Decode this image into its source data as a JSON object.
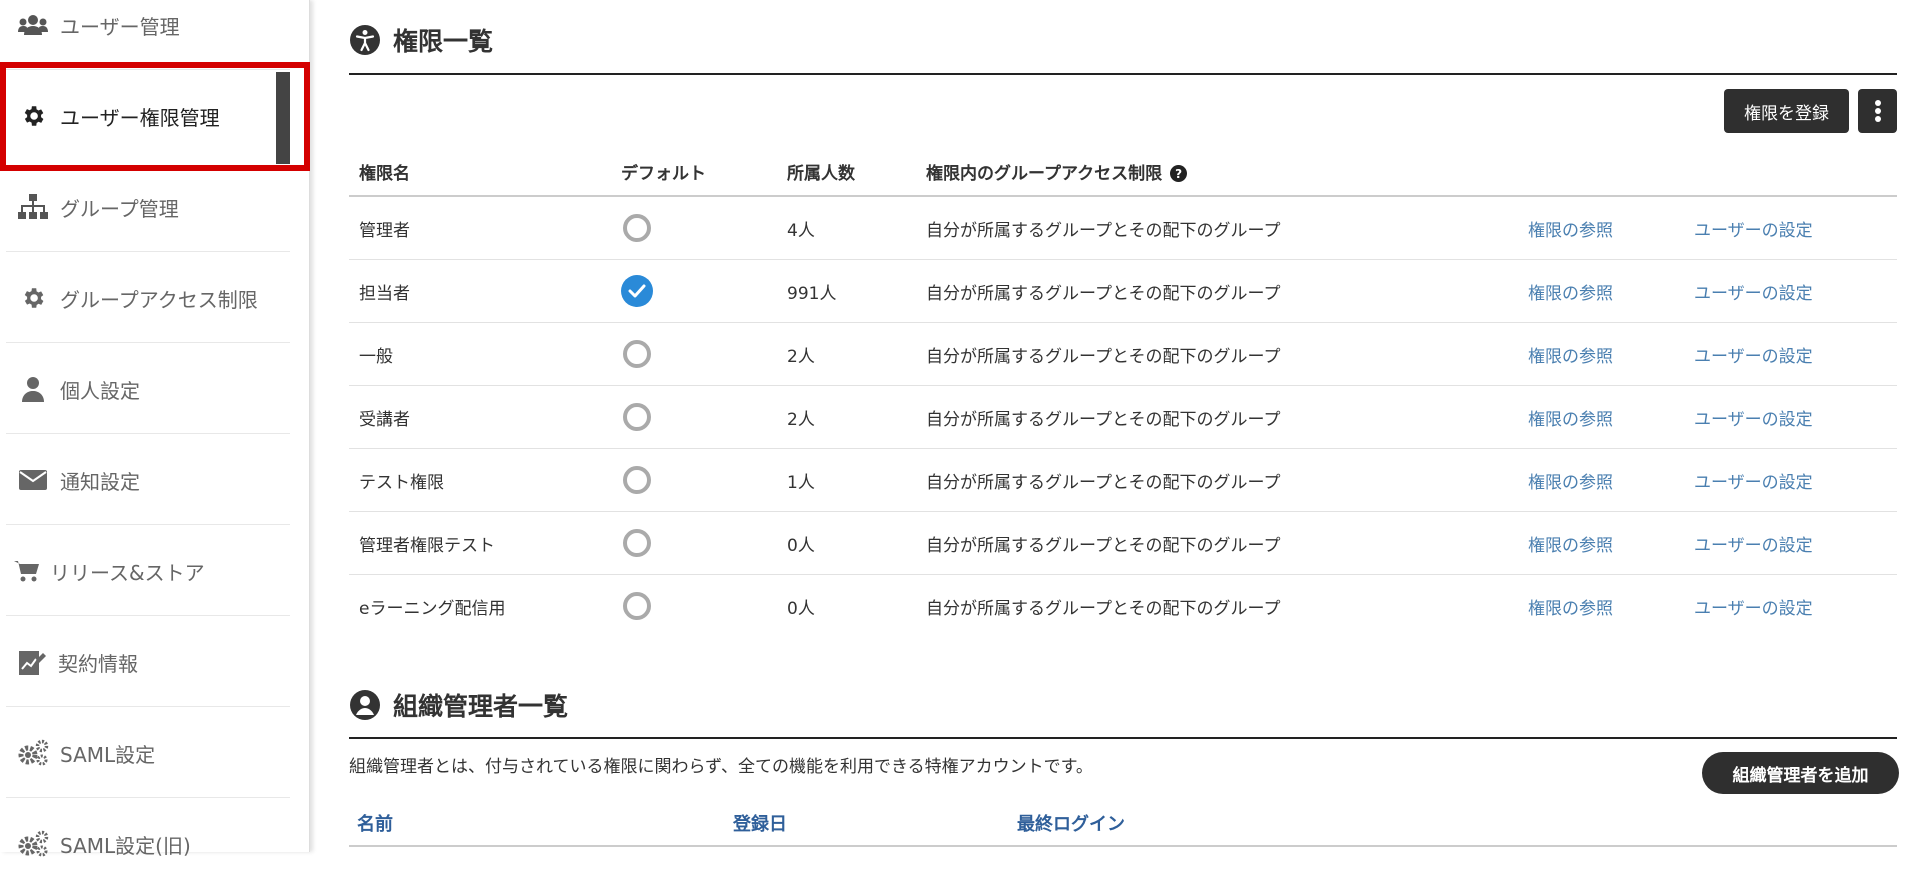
{
  "sidebar": {
    "items": [
      {
        "label": "ユーザー管理",
        "icon": "users-icon"
      },
      {
        "label": "ユーザー権限管理",
        "icon": "gear-icon",
        "active": true
      },
      {
        "label": "グループ管理",
        "icon": "sitemap-icon"
      },
      {
        "label": "グループアクセス制限",
        "icon": "gear-icon"
      },
      {
        "label": "個人設定",
        "icon": "user-icon"
      },
      {
        "label": "通知設定",
        "icon": "envelope-icon"
      },
      {
        "label": "リリース&ストア",
        "icon": "cart-icon"
      },
      {
        "label": "契約情報",
        "icon": "contract-icon"
      },
      {
        "label": "SAML設定",
        "icon": "gears-icon"
      },
      {
        "label": "SAML設定(旧)",
        "icon": "gears-icon"
      }
    ]
  },
  "permissions": {
    "title": "権限一覧",
    "register_button": "権限を登録",
    "columns": {
      "name": "権限名",
      "default": "デフォルト",
      "members": "所属人数",
      "group_access": "権限内のグループアクセス制限",
      "help": "?"
    },
    "rows": [
      {
        "name": "管理者",
        "default": false,
        "members": "4人",
        "access": "自分が所属するグループとその配下のグループ",
        "view": "権限の参照",
        "users": "ユーザーの設定"
      },
      {
        "name": "担当者",
        "default": true,
        "members": "991人",
        "access": "自分が所属するグループとその配下のグループ",
        "view": "権限の参照",
        "users": "ユーザーの設定"
      },
      {
        "name": "一般",
        "default": false,
        "members": "2人",
        "access": "自分が所属するグループとその配下のグループ",
        "view": "権限の参照",
        "users": "ユーザーの設定"
      },
      {
        "name": "受講者",
        "default": false,
        "members": "2人",
        "access": "自分が所属するグループとその配下のグループ",
        "view": "権限の参照",
        "users": "ユーザーの設定"
      },
      {
        "name": "テスト権限",
        "default": false,
        "members": "1人",
        "access": "自分が所属するグループとその配下のグループ",
        "view": "権限の参照",
        "users": "ユーザーの設定"
      },
      {
        "name": "管理者権限テスト",
        "default": false,
        "members": "0人",
        "access": "自分が所属するグループとその配下のグループ",
        "view": "権限の参照",
        "users": "ユーザーの設定"
      },
      {
        "name": "eラーニング配信用",
        "default": false,
        "members": "0人",
        "access": "自分が所属するグループとその配下のグループ",
        "view": "権限の参照",
        "users": "ユーザーの設定"
      }
    ]
  },
  "org_admins": {
    "title": "組織管理者一覧",
    "description": "組織管理者とは、付与されている権限に関わらず、全ての機能を利用できる特権アカウントです。",
    "add_button": "組織管理者を追加",
    "columns": {
      "name": "名前",
      "registered": "登録日",
      "last_login": "最終ログイン"
    }
  },
  "colors": {
    "accent_check": "#2a8ad8",
    "link": "#4a7fb0",
    "header_link": "#2f5f9a",
    "active_frame": "#d40000",
    "dark_button": "#2f2f2f"
  }
}
